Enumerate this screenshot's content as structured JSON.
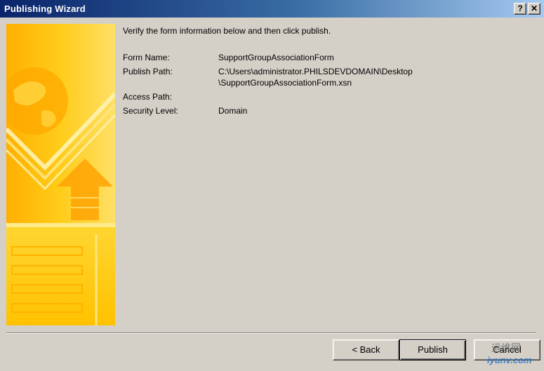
{
  "window": {
    "title": "Publishing Wizard",
    "help_label": "?",
    "close_label": "✕"
  },
  "heading": "Verify the form information below and then click publish.",
  "fields": {
    "form_name": {
      "label": "Form Name:",
      "value": "SupportGroupAssociationForm"
    },
    "publish_path": {
      "label": "Publish Path:",
      "value": "C:\\Users\\administrator.PHILSDEVDOMAIN\\Desktop\n\\SupportGroupAssociationForm.xsn"
    },
    "access_path": {
      "label": "Access Path:",
      "value": ""
    },
    "security_level": {
      "label": "Security Level:",
      "value": "Domain"
    }
  },
  "buttons": {
    "back": "< Back",
    "publish": "Publish",
    "cancel": "Cancel"
  },
  "watermark": {
    "top": "运维网",
    "bottom": "iyunv.com"
  },
  "colors": {
    "title_bar": "#0a246a",
    "dialog_bg": "#d4d0c8",
    "art_yellow": "#ffcc00"
  }
}
